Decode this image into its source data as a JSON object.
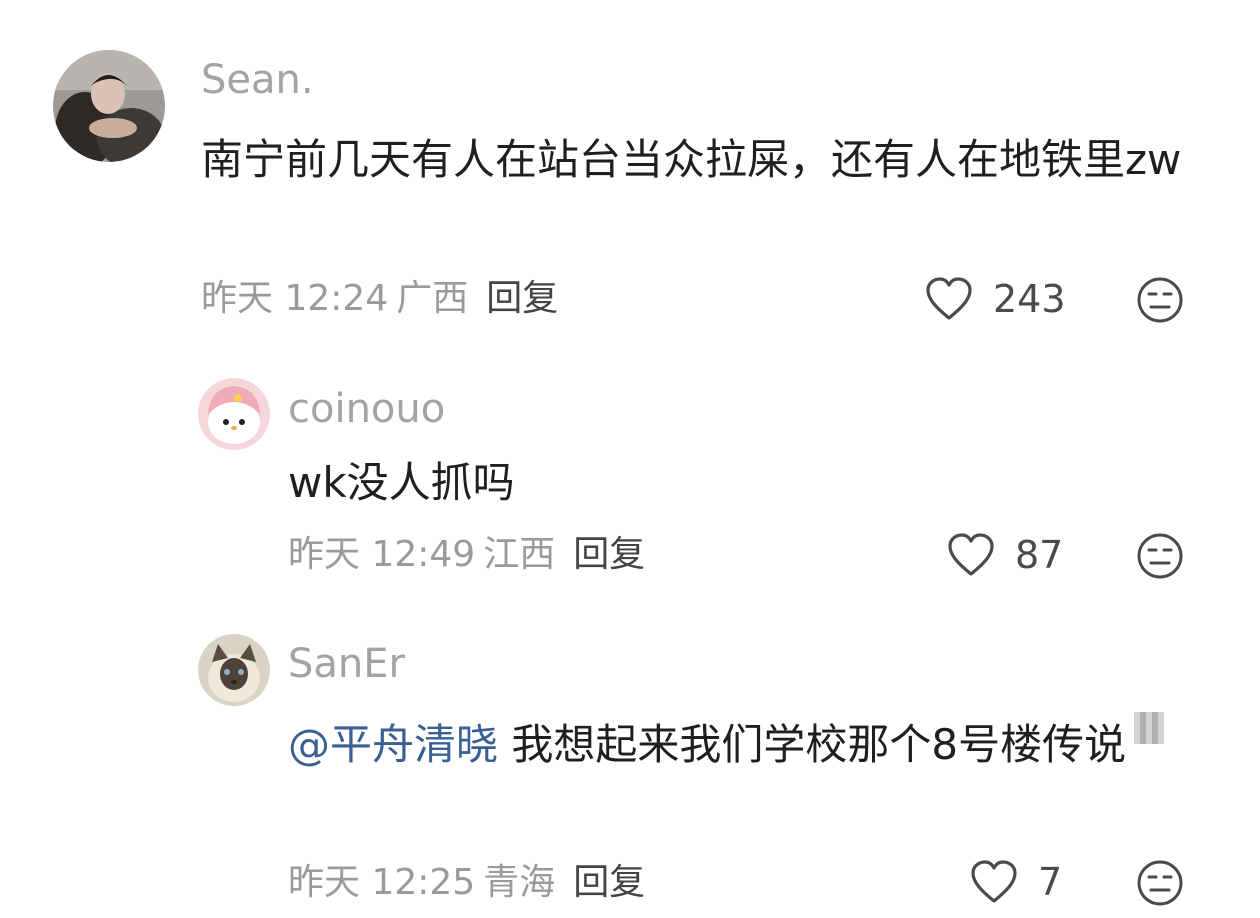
{
  "comments": [
    {
      "username": "Sean.",
      "text": "南宁前几天有人在站台当众拉屎，还有人在地铁里zw",
      "time": "昨天 12:24",
      "location": "广西",
      "reply_label": "回复",
      "likes": "243",
      "avatar_icon": "person-photo-avatar"
    },
    {
      "username": "coinouo",
      "text": "wk没人抓吗",
      "time": "昨天 12:49",
      "location": "江西",
      "reply_label": "回复",
      "likes": "87",
      "avatar_icon": "cartoon-bunny-avatar"
    },
    {
      "username": "SanEr",
      "mention": "@平舟清晓",
      "text": "我想起来我们学校那个8号楼传说",
      "time": "昨天 12:25",
      "location": "青海",
      "reply_label": "回复",
      "likes": "7",
      "avatar_icon": "cat-photo-avatar"
    }
  ],
  "colors": {
    "mention": "#3a5f93",
    "username": "#a3a3a3",
    "meta": "#9a9a9a",
    "text": "#1f1f1f"
  }
}
